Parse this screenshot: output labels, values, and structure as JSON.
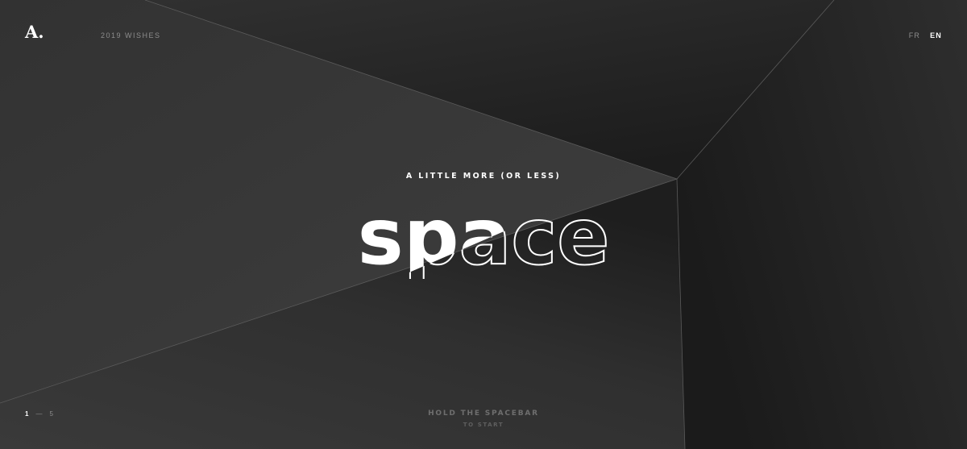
{
  "header": {
    "logo": "A.",
    "site_label": "2019 WISHES",
    "languages": [
      {
        "label": "FR",
        "active": false
      },
      {
        "label": "EN",
        "active": true
      }
    ]
  },
  "hero": {
    "tagline": "A LITTLE MORE (OR LESS)",
    "headline": "space"
  },
  "pagination": {
    "current": "1",
    "separator": "—",
    "total": "5"
  },
  "cta": {
    "line1": "HOLD THE SPACEBAR",
    "line2": "TO START"
  },
  "colors": {
    "background": "#2a2a2a",
    "text_primary": "#ffffff",
    "text_muted": "#8d8d8d",
    "cta": "#6e6e6e"
  }
}
